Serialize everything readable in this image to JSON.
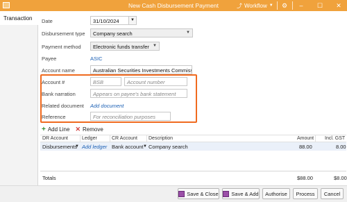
{
  "window": {
    "title": "New Cash Disbursement Payment",
    "workflow_label": "Workflow",
    "controls": [
      "–",
      "☐",
      "✕"
    ]
  },
  "tabs": [
    {
      "label": "Transaction",
      "active": true
    }
  ],
  "form": {
    "date": {
      "label": "Date",
      "value": "31/10/2024"
    },
    "disbursement_type": {
      "label": "Disbursement type",
      "value": "Company search"
    },
    "payment_method": {
      "label": "Payment method",
      "value": "Electronic funds transfer"
    },
    "payee": {
      "label": "Payee",
      "value": "ASIC"
    },
    "account_name": {
      "label": "Account name",
      "value": "Australian Securities Investments Commission"
    },
    "account_number": {
      "label": "Account #",
      "bsb_placeholder": "BSB",
      "number_placeholder": "Account number"
    },
    "bank_narration": {
      "label": "Bank narration",
      "placeholder": "Appears on payee's bank statement"
    },
    "related_document": {
      "label": "Related document",
      "link": "Add document"
    },
    "reference": {
      "label": "Reference",
      "placeholder": "For reconciliation purposes"
    }
  },
  "lines_toolbar": {
    "add_label": "Add Line",
    "remove_label": "Remove"
  },
  "grid": {
    "headers": [
      "DR Account",
      "Ledger",
      "CR Account",
      "Description",
      "Amount",
      "Incl. GST"
    ],
    "rows": [
      {
        "dr_account": "Disbursements",
        "ledger": "Add ledger",
        "cr_account": "Bank account",
        "description": "Company search",
        "amount": "88.00",
        "gst": "8.00"
      }
    ]
  },
  "totals": {
    "label": "Totals",
    "amount": "$88.00",
    "gst": "$8.00"
  },
  "footer": {
    "save_close": "Save & Close",
    "save_add": "Save & Add",
    "authorise": "Authorise",
    "process": "Process",
    "cancel": "Cancel"
  },
  "colors": {
    "title_bar": "#f0a23c",
    "highlight": "#f06a1e",
    "link": "#1a5fb4"
  }
}
